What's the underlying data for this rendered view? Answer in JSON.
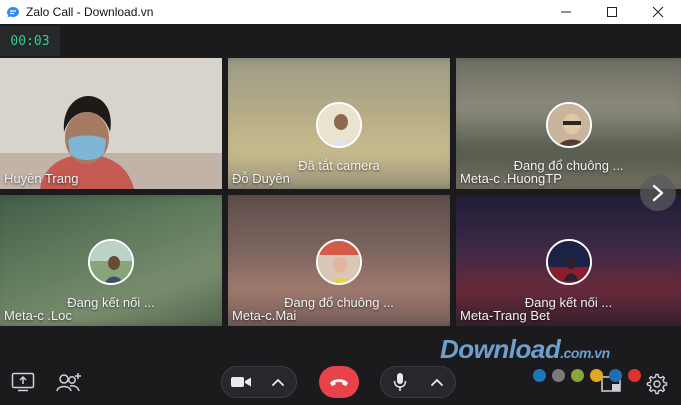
{
  "window": {
    "title": "Zalo Call - Download.vn",
    "controls": [
      "minimize-icon",
      "maximize-icon",
      "close-icon"
    ]
  },
  "call": {
    "timer": "00:03"
  },
  "participants": [
    {
      "name": "Huyền Trang",
      "status": "",
      "camera_on": true
    },
    {
      "name": "Đỗ Duyên",
      "status": "Đã tắt camera",
      "camera_on": false
    },
    {
      "name": "Meta-c .HuongTP",
      "status": "Đang đổ chuông ...",
      "camera_on": false
    },
    {
      "name": "Meta-c .Loc",
      "status": "Đang kết nối ...",
      "camera_on": false
    },
    {
      "name": "Meta-c.Mai",
      "status": "Đang đổ chuông ...",
      "camera_on": false
    },
    {
      "name": "Meta-Trang Bet",
      "status": "Đang kết nối ...",
      "camera_on": false
    }
  ],
  "toolbar": {
    "left_icons": [
      "screen-share-icon",
      "add-participant-icon"
    ],
    "center": [
      "camera-icon",
      "chevron-up-icon",
      "end-call-icon",
      "microphone-icon",
      "chevron-up-icon"
    ],
    "right_icons": [
      "layout-icon",
      "settings-icon"
    ]
  },
  "watermark": {
    "main": "Download",
    "suffix": ".com.vn",
    "dot_colors": [
      "#1d77b8",
      "#7a7a7a",
      "#8aa63a",
      "#e0a823",
      "#1f6fb5",
      "#d9352e"
    ]
  },
  "colors": {
    "timer_text": "#35d18a",
    "end_call": "#e8434a",
    "active_border": "#2a6fd6"
  }
}
